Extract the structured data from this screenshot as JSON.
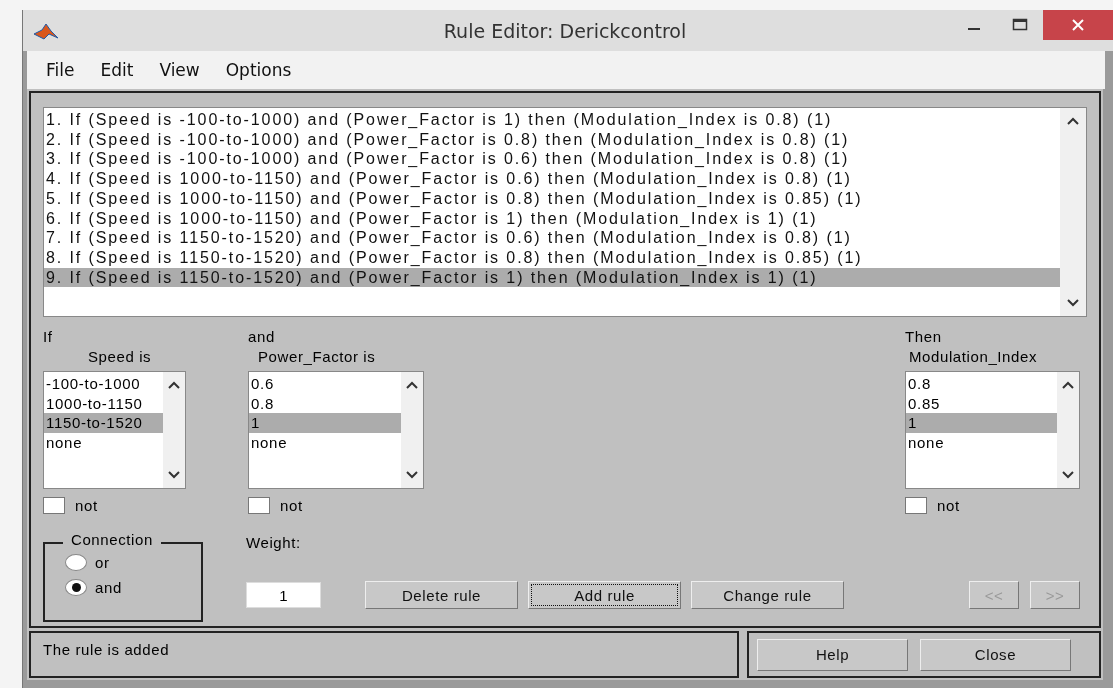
{
  "window": {
    "title": "Rule Editor: Derickcontrol"
  },
  "menu": [
    "File",
    "Edit",
    "View",
    "Options"
  ],
  "rules": [
    {
      "text": "1. If (Speed is -100-to-1000) and (Power_Factor is 1) then (Modulation_Index is 0.8) (1)",
      "selected": false
    },
    {
      "text": "2. If (Speed is -100-to-1000) and (Power_Factor is 0.8) then (Modulation_Index is 0.8) (1)",
      "selected": false
    },
    {
      "text": "3. If (Speed is -100-to-1000) and (Power_Factor is 0.6) then (Modulation_Index is 0.8) (1)",
      "selected": false
    },
    {
      "text": "4. If (Speed is 1000-to-1150) and (Power_Factor is 0.6) then (Modulation_Index is 0.8) (1)",
      "selected": false
    },
    {
      "text": "5. If (Speed is 1000-to-1150) and (Power_Factor is 0.8) then (Modulation_Index is 0.85) (1)",
      "selected": false
    },
    {
      "text": "6. If (Speed is 1000-to-1150) and (Power_Factor is 1) then (Modulation_Index is 1) (1)",
      "selected": false
    },
    {
      "text": "7. If (Speed is 1150-to-1520) and (Power_Factor is 0.6) then (Modulation_Index is 0.8) (1)",
      "selected": false
    },
    {
      "text": "8. If (Speed is 1150-to-1520) and (Power_Factor is 0.8) then (Modulation_Index is 0.85) (1)",
      "selected": false
    },
    {
      "text": "9. If (Speed is 1150-to-1520) and (Power_Factor is 1) then (Modulation_Index is 1) (1)",
      "selected": true
    }
  ],
  "columns": [
    {
      "heading": "If",
      "label": "Speed is",
      "options": [
        {
          "label": "-100-to-1000",
          "selected": false
        },
        {
          "label": "1000-to-1150",
          "selected": false
        },
        {
          "label": "1150-to-1520",
          "selected": true
        },
        {
          "label": "none",
          "selected": false
        }
      ],
      "not": {
        "label": "not",
        "checked": false
      }
    },
    {
      "heading": "and",
      "label": "Power_Factor is",
      "options": [
        {
          "label": "0.6",
          "selected": false
        },
        {
          "label": "0.8",
          "selected": false
        },
        {
          "label": "1",
          "selected": true
        },
        {
          "label": "none",
          "selected": false
        }
      ],
      "not": {
        "label": "not",
        "checked": false
      }
    },
    {
      "heading": "Then",
      "label": "Modulation_Index",
      "options": [
        {
          "label": "0.8",
          "selected": false
        },
        {
          "label": "0.85",
          "selected": false
        },
        {
          "label": "1",
          "selected": true
        },
        {
          "label": "none",
          "selected": false
        }
      ],
      "not": {
        "label": "not",
        "checked": false
      }
    }
  ],
  "connection": {
    "title": "Connection",
    "options": [
      {
        "label": "or",
        "selected": false
      },
      {
        "label": "and",
        "selected": true
      }
    ]
  },
  "weight": {
    "label": "Weight:",
    "value": "1"
  },
  "actions": [
    {
      "label": "Delete rule",
      "focused": false
    },
    {
      "label": "Add rule",
      "focused": true
    },
    {
      "label": "Change rule",
      "focused": false
    }
  ],
  "nav": [
    {
      "label": "<<",
      "disabled": true
    },
    {
      "label": ">>",
      "disabled": true
    }
  ],
  "status": "The rule is added",
  "footer_buttons": [
    "Help",
    "Close"
  ]
}
